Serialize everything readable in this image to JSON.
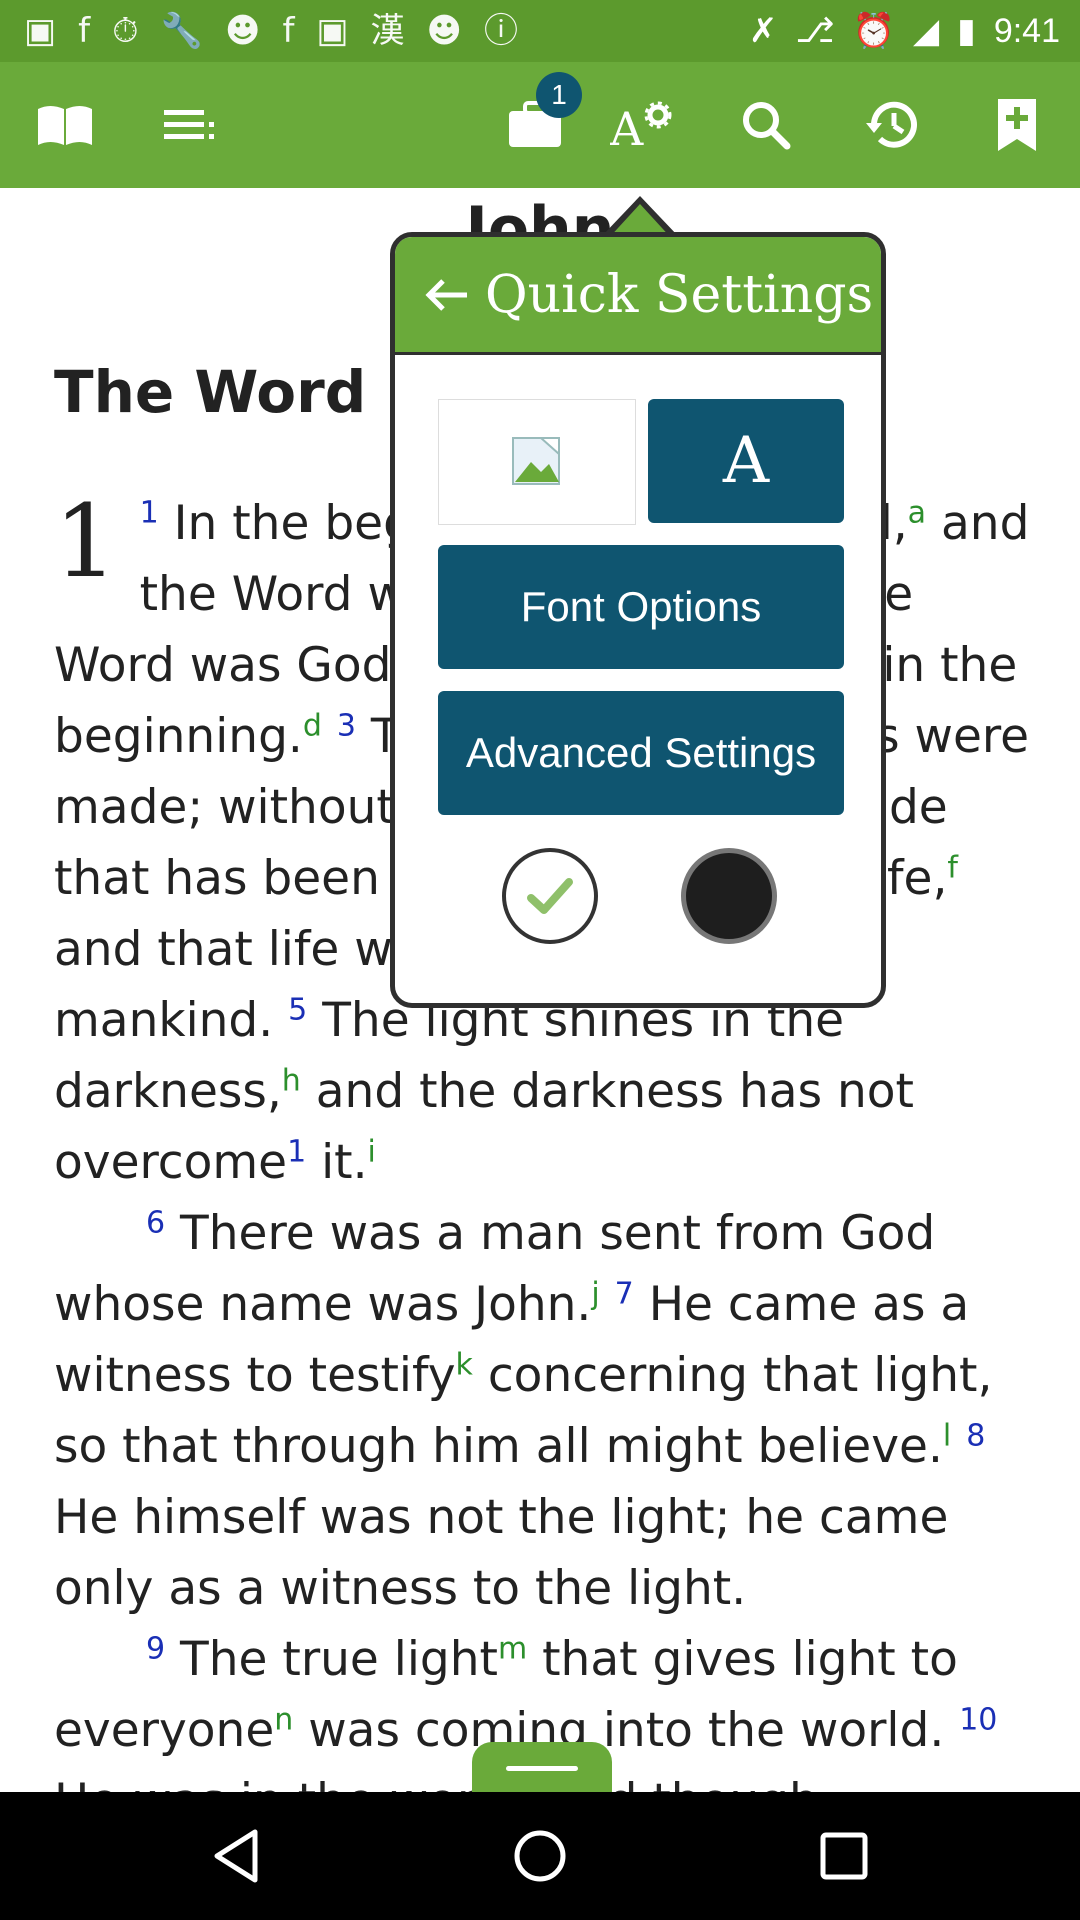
{
  "status_bar": {
    "time": "9:41",
    "left_icons": [
      "message-icon",
      "facebook-icon",
      "stopwatch-icon",
      "wrench-icon",
      "smiley-icon",
      "facebook-icon",
      "qt-icon",
      "chinese-icon",
      "smiley-icon",
      "info-icon"
    ],
    "right_icons": [
      "no-signal-icon",
      "bluetooth-icon",
      "alarm-icon",
      "wifi-icon",
      "battery-icon"
    ]
  },
  "toolbar": {
    "buttons": [
      "book-icon",
      "menu-icon",
      "briefcase-icon",
      "text-settings-icon",
      "search-icon",
      "history-icon",
      "bookmark-add-icon"
    ],
    "badge_count": "1"
  },
  "content": {
    "book_title": "John",
    "section_heading": "The Word Became Flesh",
    "chapter_number": "1"
  },
  "quick_settings": {
    "title": "Quick Settings",
    "font_button": "A",
    "font_options": "Font Options",
    "advanced_settings": "Advanced Settings",
    "theme_light_selected": "✓"
  },
  "colors": {
    "toolbar_green": "#6aaa3a",
    "statusbar_green": "#5c9a2d",
    "button_blue": "#0f5570",
    "verse_blue": "#1a2fb5",
    "footnote_green": "#2c8f2c"
  }
}
